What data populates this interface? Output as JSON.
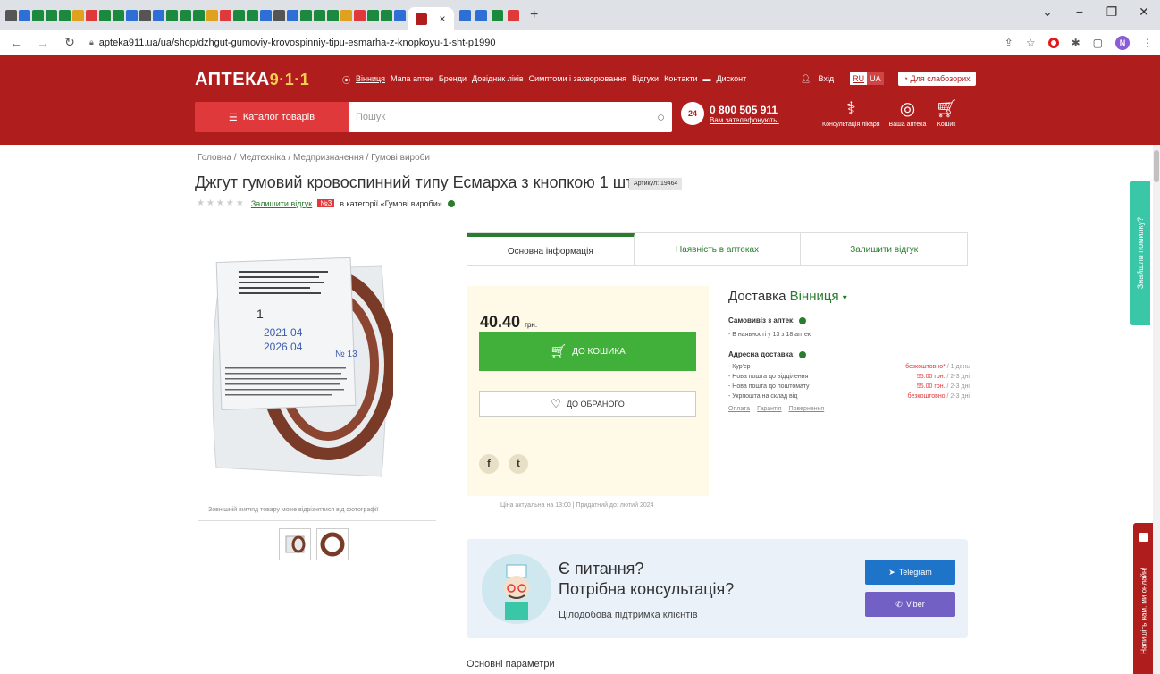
{
  "browser": {
    "tab_close": "×",
    "new_tab": "+",
    "url": "apteka911.ua/ua/shop/dzhgut-gumoviy-krovospinniy-tipu-esmarha-z-knopkoyu-1-sht-p1990",
    "profile_initial": "N"
  },
  "header": {
    "logo_text": "АПТЕКА",
    "logo_num": "9·1·1",
    "nav": {
      "city": "Вінниця",
      "items": [
        "Мапа аптек",
        "Бренди",
        "Довідник ліків",
        "Симптоми і захворювання",
        "Відгуки",
        "Контакти",
        "Дисконт"
      ]
    },
    "login": "Вхід",
    "lang_ru": "RU",
    "lang_ua": "UA",
    "weak_sight": "Для слабозорих",
    "catalog": "Каталог товарів",
    "search_placeholder": "Пошук",
    "phone_badge": "24",
    "phone": "0 800 505 911",
    "phone_sub": "Вам зателефонують!",
    "icons": {
      "doctor": "Консультація лікаря",
      "pharmacy": "Ваша аптека",
      "cart": "Кошик"
    }
  },
  "breadcrumb": [
    "Головна",
    "Медтехніка",
    "Медпризначення",
    "Гумові вироби"
  ],
  "product": {
    "title": "Джгут гумовий кровоспинний типу Есмарха з кнопкою 1 шт",
    "article": "Артикул: 19464",
    "review_link": "Залишити відгук",
    "rank_badge": "№3",
    "rank_text": "в категорії «Гумові вироби»",
    "image_caption": "Зовнішній вигляд товару може відрізнятися від фотографії",
    "tabs": [
      "Основна інформація",
      "Наявність в аптеках",
      "Залишити відгук"
    ],
    "price": "40.40",
    "currency": "грн.",
    "cart_button": "ДО КОШИКА",
    "fav_button": "ДО ОБРАНОГО",
    "price_note": "Ціна актуальна на 13:00 | Придатний до: лютий 2024"
  },
  "delivery": {
    "title": "Доставка",
    "city": "Вінниця",
    "pickup_title": "Самовивіз з аптек:",
    "pickup_line": "- В наявності у 13 з 18 аптек",
    "address_title": "Адресна доставка:",
    "rows": [
      {
        "name": "- Кур'єр",
        "price": "безкоштовно*",
        "days": "/ 1 день"
      },
      {
        "name": "- Нова пошта до відділення",
        "price": "55.00 грн.",
        "days": "/ 2-3 дні"
      },
      {
        "name": "- Нова пошта до поштомату",
        "price": "55.00 грн.",
        "days": "/ 2-3 дні"
      },
      {
        "name": "- Укрпошта на склад від",
        "price": "безкоштовно",
        "days": "/ 2-3 дні"
      }
    ],
    "links": [
      "Оплата",
      "Гарантія",
      "Повернення"
    ]
  },
  "consult": {
    "q1": "Є питання?",
    "q2": "Потрібна консультація?",
    "sub": "Цілодобова підтримка клієнтів",
    "telegram": "Telegram",
    "viber": "Viber"
  },
  "params_title": "Основні параметри",
  "side": {
    "report": "Знайшли помилку?",
    "chat": "Напишіть нам, ми онлайн!"
  },
  "colors": {
    "brand_red": "#b01d1d",
    "accent_green": "#41b03a",
    "link_green": "#2a7d2e"
  }
}
